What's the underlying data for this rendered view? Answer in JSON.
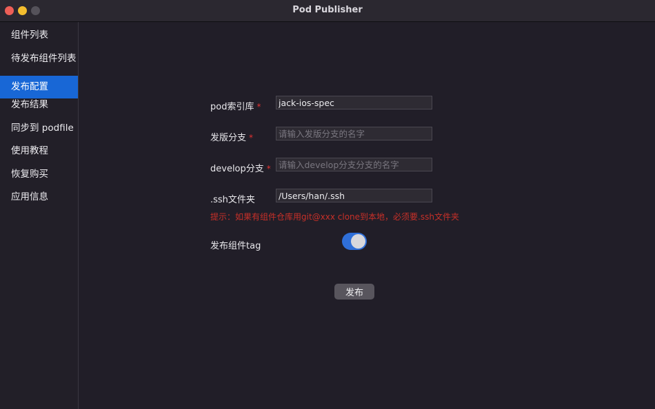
{
  "window": {
    "title": "Pod Publisher"
  },
  "sidebar": {
    "items": [
      {
        "label": "组件列表"
      },
      {
        "label": "待发布组件列表"
      },
      {
        "label": "发布配置",
        "active": true
      },
      {
        "label": "发布结果"
      },
      {
        "label": "同步到 podfile"
      },
      {
        "label": "使用教程"
      },
      {
        "label": "恢复购买"
      },
      {
        "label": "应用信息"
      }
    ]
  },
  "form": {
    "pod_repo": {
      "label": "pod索引库",
      "required_mark": "*",
      "value": "jack-ios-spec",
      "placeholder": ""
    },
    "release_branch": {
      "label": "发版分支",
      "required_mark": "*",
      "value": "",
      "placeholder": "请输入发版分支的名字"
    },
    "develop_branch": {
      "label": "develop分支",
      "required_mark": "*",
      "value": "",
      "placeholder": "请输入develop分支分支的名字"
    },
    "ssh_folder": {
      "label": ".ssh文件夹",
      "value": "/Users/han/.ssh",
      "placeholder": ""
    },
    "hint": "提示：如果有组件仓库用git@xxx clone到本地，必须要.ssh文件夹",
    "publish_tag": {
      "label": "发布组件tag",
      "enabled": true
    },
    "publish_button": "发布"
  },
  "colors": {
    "accent": "#1867d6",
    "required": "#e23232",
    "hint": "#c83028",
    "toggle_on": "#2f6fd8"
  }
}
